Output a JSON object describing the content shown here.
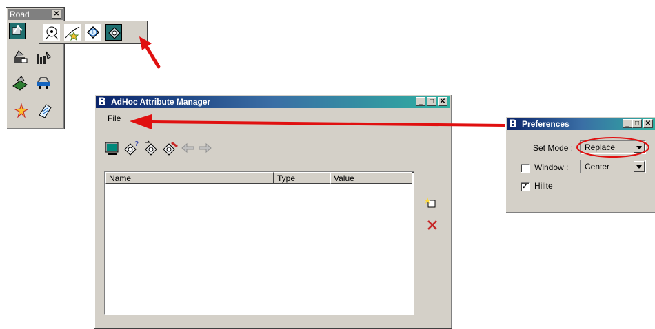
{
  "road_toolbar": {
    "title": "Road",
    "close_label": "✕",
    "tools": [
      "road-design-icon",
      "traffic-icon",
      "road-sparkle-icon",
      "info-tag-icon",
      "attribute-tag-icon"
    ],
    "side_tools": [
      "vehicle-terrain-icon",
      "bar-chart-icon",
      "green-surface-icon",
      "cross-section-icon",
      "sparkle-icon",
      "notepad-icon"
    ]
  },
  "adhoc_window": {
    "title": "AdHoc Attribute Manager",
    "menu": {
      "file": "File"
    },
    "toolbar": [
      "monitor-icon",
      "tag-query-icon",
      "tag-copy-icon",
      "tag-edit-icon",
      "arrow-left-icon",
      "arrow-right-icon"
    ],
    "table": {
      "columns": [
        "Name",
        "Type",
        "Value"
      ],
      "rows": []
    },
    "side_buttons": [
      "new-attribute-icon",
      "delete-icon"
    ]
  },
  "preferences_window": {
    "title": "Preferences",
    "set_mode_label": "Set Mode :",
    "set_mode_value": "Replace",
    "window_label": "Window :",
    "window_value": "Center",
    "window_checked": false,
    "hilite_label": "Hilite",
    "hilite_checked": true,
    "check_mark": "✓"
  },
  "colors": {
    "annotation_arrow": "#e01010",
    "title_gradient_start": "#0a246a",
    "title_gradient_end": "#2fb0a0",
    "dialog_face": "#d4d0c8"
  }
}
